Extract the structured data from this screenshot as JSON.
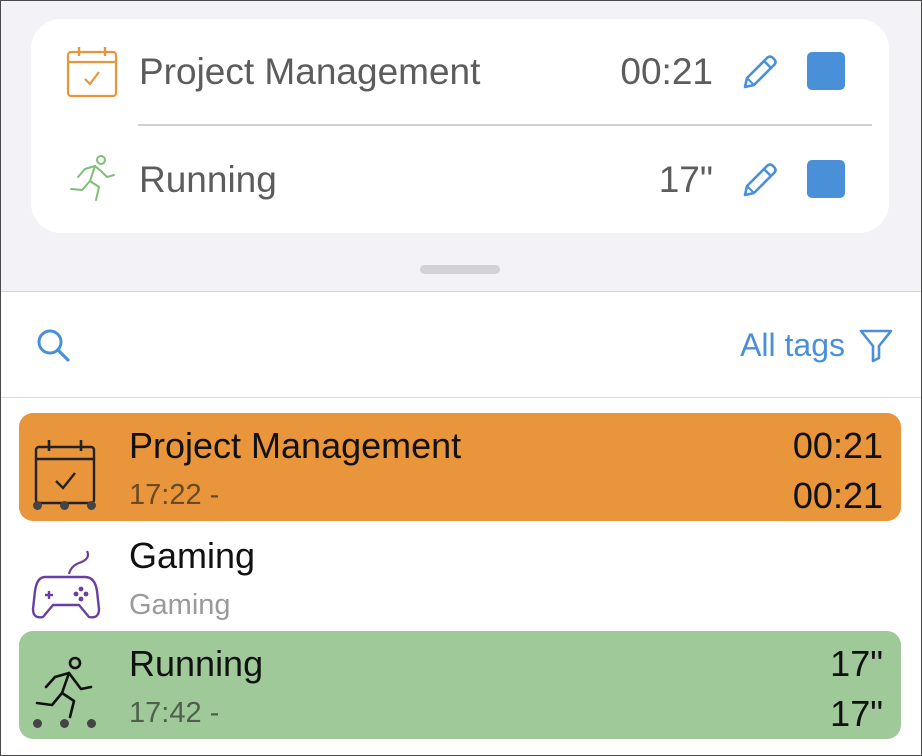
{
  "active_timers": [
    {
      "name": "Project Management",
      "duration": "00:21",
      "icon": "calendar-check-icon",
      "icon_color": "#e8953b",
      "edit_icon": "pencil-icon",
      "stop_icon": "stop-square-icon"
    },
    {
      "name": "Running",
      "duration": "17\"",
      "icon": "runner-icon",
      "icon_color": "#7dbf76",
      "edit_icon": "pencil-icon",
      "stop_icon": "stop-square-icon"
    }
  ],
  "toolbar": {
    "search_icon": "search-icon",
    "tags_filter_label": "All tags",
    "filter_icon": "filter-icon"
  },
  "list": [
    {
      "title": "Project Management",
      "subtitle": "17:22 -",
      "duration_primary": "00:21",
      "duration_secondary": "00:21",
      "icon": "calendar-check-icon",
      "background": "#e8953b",
      "running": true
    },
    {
      "title": "Gaming",
      "subtitle": "Gaming",
      "icon": "gamepad-icon",
      "icon_color": "#6b3fa0",
      "background": "#ffffff",
      "running": false
    },
    {
      "title": "Running",
      "subtitle": "17:42 -",
      "duration_primary": "17\"",
      "duration_secondary": "17\"",
      "icon": "runner-icon",
      "background": "#a0c99a",
      "running": true
    }
  ],
  "colors": {
    "accent": "#4a90d9",
    "stop_button": "#4a90d9"
  }
}
